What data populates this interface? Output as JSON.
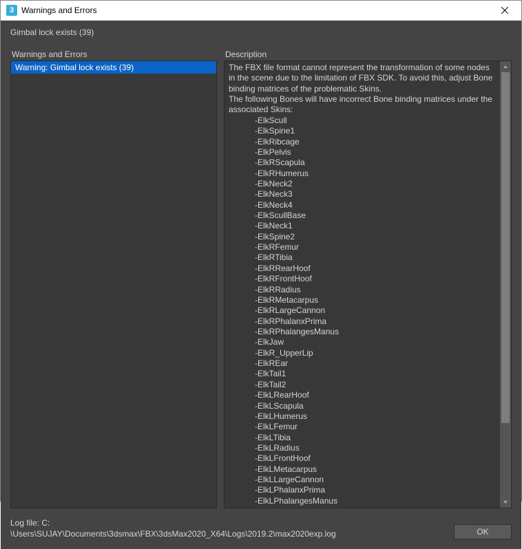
{
  "window": {
    "title": "Warnings and Errors",
    "icon_label": "3"
  },
  "header": {
    "summary": "Gimbal lock exists (39)"
  },
  "panels": {
    "left_label": "Warnings and Errors",
    "right_label": "Description",
    "items": [
      {
        "label": "Warning: Gimbal lock exists (39)",
        "selected": true
      }
    ]
  },
  "description": {
    "intro": [
      "The FBX file format cannot represent the transformation of some nodes in the scene due to the limitation of FBX SDK. To avoid this, adjust Bone binding matrices of the problematic Skins.",
      "The following Bones will have incorrect Bone binding matrices under the associated Skins:"
    ],
    "bones": [
      "-ElkScull",
      "-ElkSpine1",
      "-ElkRibcage",
      "-ElkPelvis",
      "-ElkRScapula",
      "-ElkRHumerus",
      "-ElkNeck2",
      "-ElkNeck3",
      "-ElkNeck4",
      "-ElkScullBase",
      "-ElkNeck1",
      "-ElkSpine2",
      "-ElkRFemur",
      "-ElkRTibia",
      "-ElkRRearHoof",
      "-ElkRFrontHoof",
      "-ElkRRadius",
      "-ElkRMetacarpus",
      "-ElkRLargeCannon",
      "-ElkRPhalanxPrima",
      "-ElkRPhalangesManus",
      "-ElkJaw",
      "-ElkR_UpperLip",
      "-ElkREar",
      "-ElkTail1",
      "-ElkTail2",
      "-ElkLRearHoof",
      "-ElkLScapula",
      "-ElkLHumerus",
      "-ElkLFemur",
      "-ElkLTibia",
      "-ElkLRadius",
      "-ElkLFrontHoof",
      "-ElkLMetacarpus",
      "-ElkLLargeCannon",
      "-ElkLPhalanxPrima",
      "-ElkLPhalangesManus"
    ]
  },
  "footer": {
    "log_label": "Log file: C:",
    "log_path": "\\Users\\SUJAY\\Documents\\3dsmax\\FBX\\3dsMax2020_X64\\Logs\\2019.2\\max2020exp.log",
    "ok_label": "OK"
  }
}
